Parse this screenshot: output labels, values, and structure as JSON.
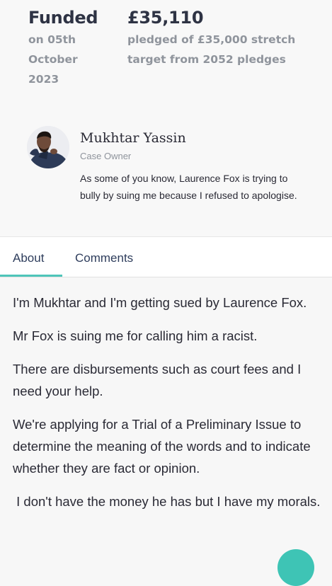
{
  "stats": {
    "funded": {
      "value": "Funded",
      "line1": "on 05th",
      "line2": "October",
      "line3": "2023"
    },
    "pledged": {
      "value": "£35,110",
      "line1": "pledged of £35,000 stretch",
      "line2": "target from 2052 pledges"
    }
  },
  "owner": {
    "name": "Mukhtar Yassin",
    "role": "Case Owner",
    "quote": "As some of you know, Laurence Fox is trying to bully by suing me because I refused to apologise."
  },
  "tabs": {
    "about": "About",
    "comments": "Comments",
    "active": "About"
  },
  "body": {
    "paragraphs": [
      "I'm Mukhtar and I'm getting sued by Laurence Fox.",
      "Mr Fox is suing me for calling him a racist.",
      "There are disbursements such as court fees and I need your help.",
      "We're applying for a Trial of a Preliminary Issue to determine the meaning of the words and to indicate whether they are fact or opinion.",
      " I don't have the money he has but I have my morals."
    ]
  },
  "colors": {
    "accent": "#4ec5b9",
    "heading": "#2e3344",
    "muted": "#8f949c",
    "tab_text": "#2e3d5c"
  }
}
